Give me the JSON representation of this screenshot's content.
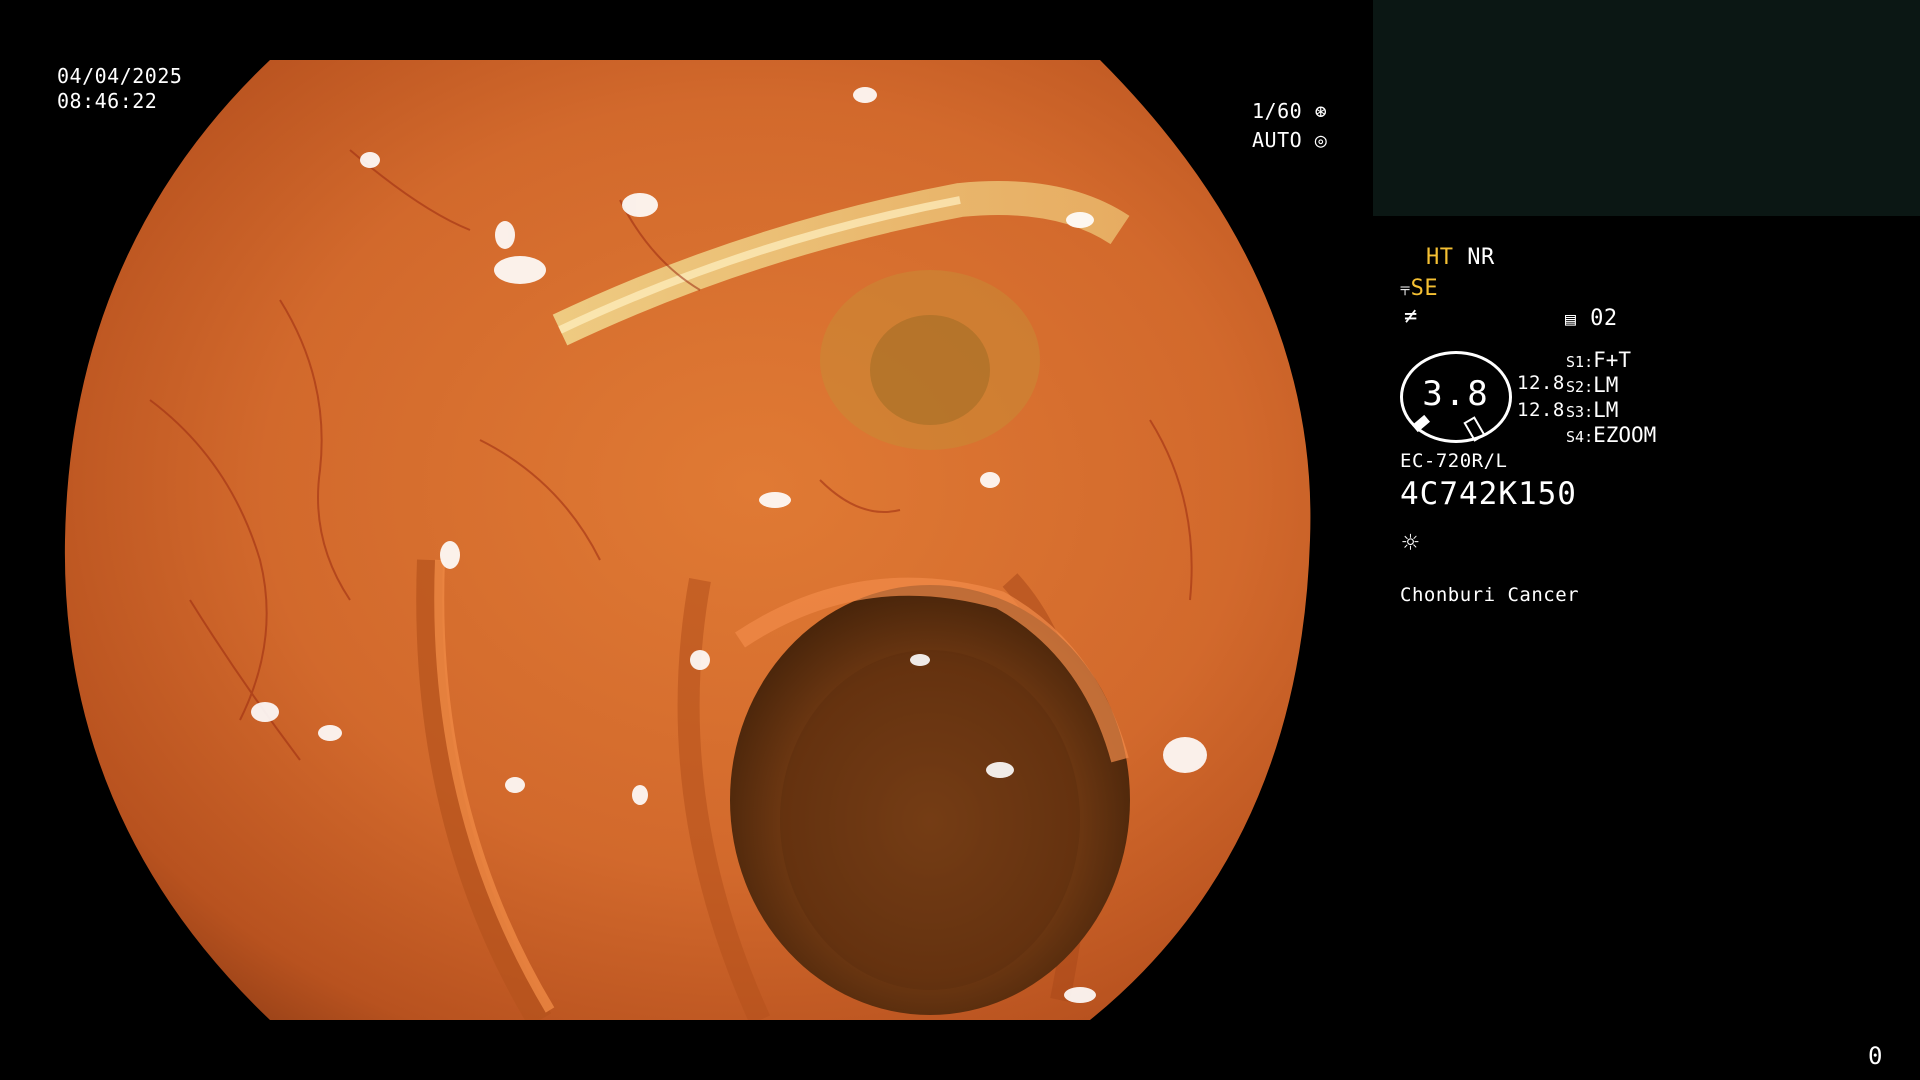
{
  "datetime": {
    "date": "04/04/2025",
    "time": "08:46:22"
  },
  "shutter": {
    "speed": "1/60",
    "iris": "AUTO",
    "speed_icon": "shutter-icon",
    "iris_icon": "iris-icon"
  },
  "settings": {
    "ht": "HT",
    "nr": "NR",
    "se": "SE",
    "mode_number": "02",
    "se_icon": "scope-settings-icon",
    "freeze_icon": "freeze-icon",
    "memory_icon": "memory-card-icon"
  },
  "gauge": {
    "value": "3.8",
    "left_top": "12.8",
    "left_bottom": "12.8"
  },
  "switches": [
    {
      "key": "S1",
      "value": "F+T"
    },
    {
      "key": "S2",
      "value": "LM"
    },
    {
      "key": "S3",
      "value": "LM"
    },
    {
      "key": "S4",
      "value": "EZOOM"
    }
  ],
  "scope": {
    "model": "EC-720R/L",
    "serial": "4C742K150"
  },
  "light_icon": "brightness-icon",
  "institution": "Chonburi Cancer",
  "counter": "0",
  "colors": {
    "accent_yellow": "#f5c033",
    "panel": "#0b1714",
    "mucosa": "#d2692c"
  }
}
